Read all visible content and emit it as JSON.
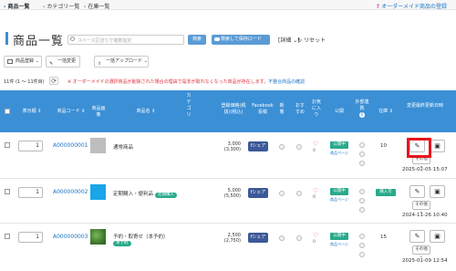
{
  "nav": {
    "items": [
      "商品一覧",
      "カテゴリ一覧",
      "在庫一覧"
    ],
    "help_label": "オーダーメイド商品の登録"
  },
  "header": {
    "title": "商品一覧",
    "search_placeholder": "スペース区切りで複数指定",
    "search_button": "検索",
    "save_button": "検索して保存ロード",
    "detail_label": "[詳細 ⌄]",
    "reset_label": "リセット"
  },
  "toolbar": {
    "register_label": "商品登録 ⌄",
    "bulk_edit_label": "一括変更",
    "bulk_upload_label": "一括アップロード ⌄"
  },
  "list": {
    "count_label": "11件 (1 〜 11件目)",
    "notice": "※ オーダーメイドの選択商品が削除された場合の理由で是非が取れなくなった商品が存在します。",
    "notice_link": "不整合商品の確認"
  },
  "table": {
    "headers": {
      "order": "表示順",
      "code": "商品コード",
      "image": "商品画像",
      "name": "商品名",
      "category": "カテゴリ",
      "price": "登録価格(税抜)(税込)",
      "facebook": "Facebook投稿",
      "new": "新着",
      "recommend": "おすすめ",
      "favorite": "お気に入り",
      "publish": "公開",
      "external": "外部連携",
      "stock": "在庫",
      "updated": "変更最終更新日時"
    },
    "rows": [
      {
        "order": "1",
        "code": "A000000001",
        "thumb_color": "#bdbdbd",
        "name": "通常商品",
        "badge": "",
        "price_ex": "3,000",
        "price_in": "(3,300)",
        "share_label": "シェア",
        "favorite_count": "0",
        "publish_status": "公開中",
        "publish_link": "商品ページ",
        "stock_label": "",
        "stock": "10",
        "other_label": "その他",
        "updated": "2025-02-05 15:07"
      },
      {
        "order": "1",
        "code": "A000000002",
        "thumb_color": "#1aa6e8",
        "name": "定期購入・便利品",
        "badge": "定期購入",
        "price_ex": "5,000",
        "price_in": "(5,500)",
        "share_label": "シェア",
        "favorite_count": "0",
        "publish_status": "公開中",
        "publish_link": "商品ページ",
        "stock_label": "購入可",
        "stock": "",
        "other_label": "その他",
        "updated": "2024-11-26 10:40"
      },
      {
        "order": "1",
        "code": "A000000003",
        "thumb_color": "#4e8a3a",
        "name": "予約・取寄せ（本予約）",
        "badge": "本予約",
        "price_ex": "2,500",
        "price_in": "(2,750)",
        "share_label": "シェア",
        "favorite_count": "0",
        "publish_status": "公開中",
        "publish_link": "商品ページ",
        "stock_label": "",
        "stock": "15",
        "other_label": "その他",
        "updated": "2025-01-09 12:54"
      }
    ]
  }
}
